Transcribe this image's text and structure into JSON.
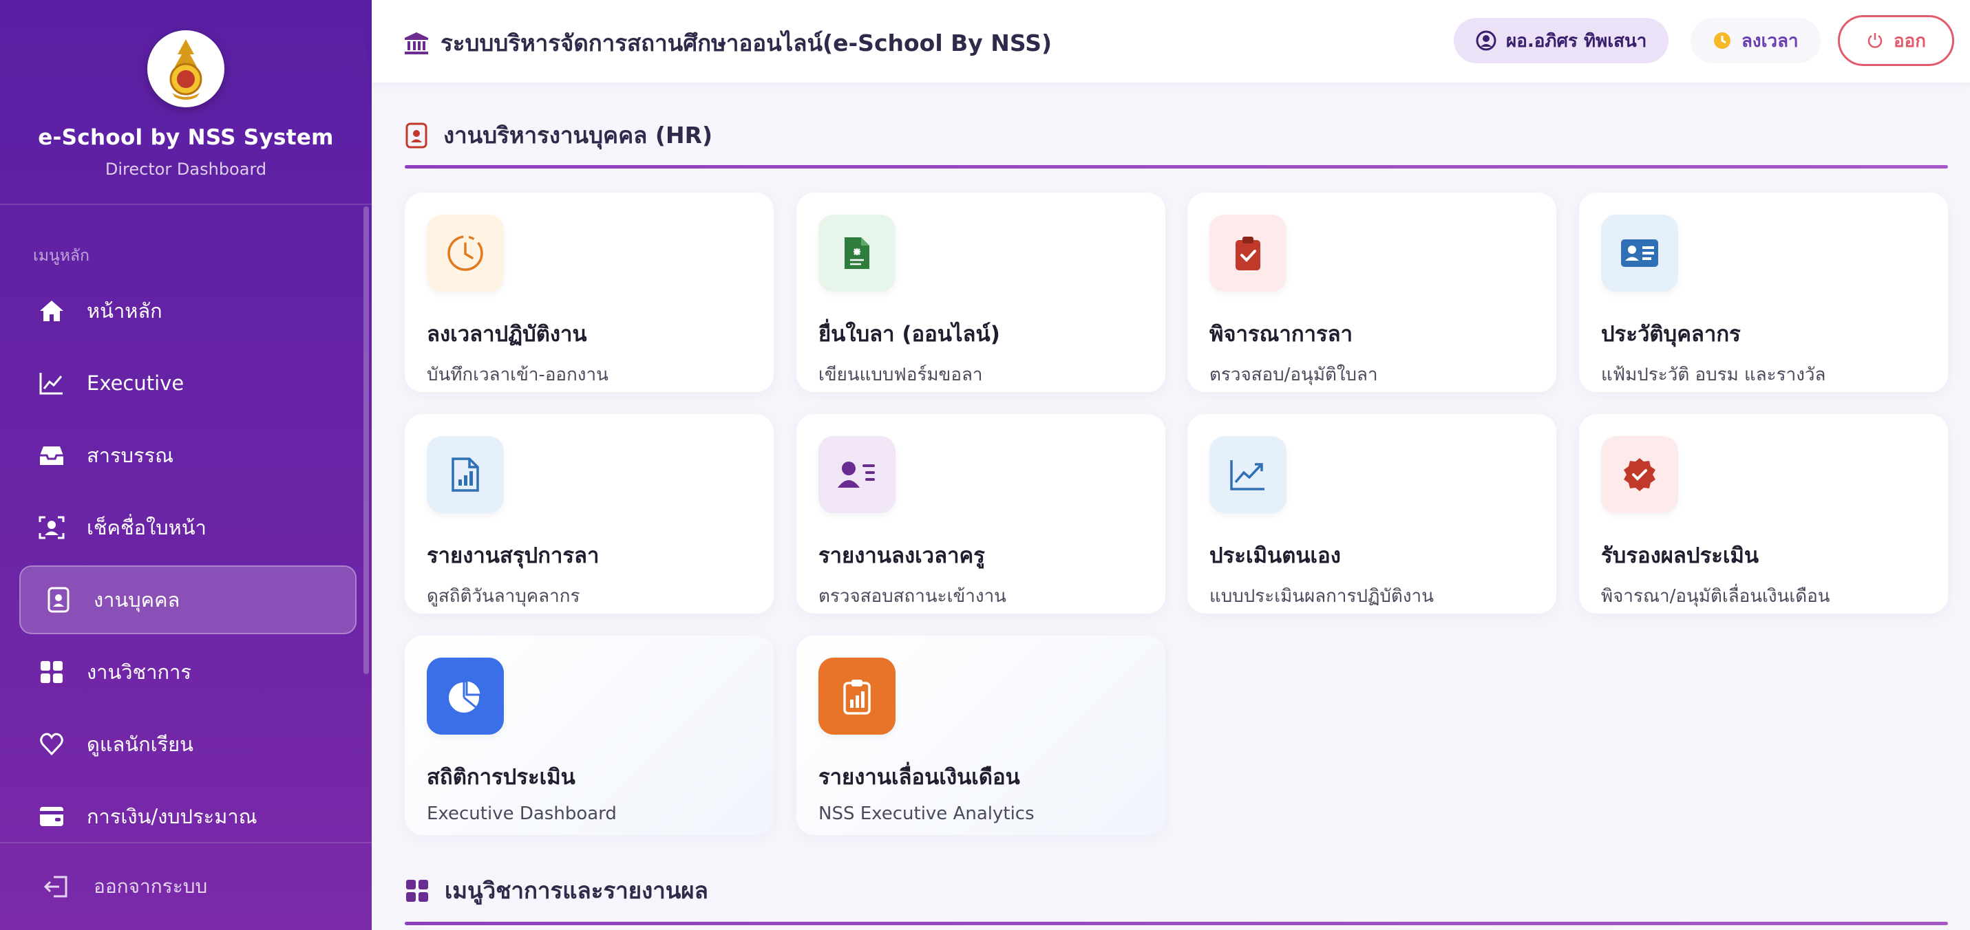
{
  "sidebar": {
    "brand_title": "e-School by NSS System",
    "brand_subtitle": "Director Dashboard",
    "menu_caption": "เมนูหลัก",
    "items": [
      {
        "label": "หน้าหลัก",
        "icon": "home-icon"
      },
      {
        "label": "Executive",
        "icon": "chart-line-icon"
      },
      {
        "label": "สารบรรณ",
        "icon": "inbox-icon"
      },
      {
        "label": "เช็คชื่อใบหน้า",
        "icon": "face-scan-icon"
      },
      {
        "label": "งานบุคคล",
        "icon": "id-badge-icon",
        "active": true
      },
      {
        "label": "งานวิชาการ",
        "icon": "grid-icon"
      },
      {
        "label": "ดูแลนักเรียน",
        "icon": "heart-icon"
      },
      {
        "label": "การเงิน/งบประมาณ",
        "icon": "wallet-icon"
      }
    ],
    "logout_label": "ออกจากระบบ"
  },
  "topbar": {
    "title": "ระบบบริหารจัดการสถานศึกษาออนไลน์(e-School By NSS)",
    "user_name": "ผอ.อภิศร ทิพเสนา",
    "clock_label": "ลงเวลา",
    "logout_label": "ออก"
  },
  "hr_section": {
    "title": "งานบริหารงานบุคคล (HR)",
    "cards": [
      {
        "title": "ลงเวลาปฏิบัติงาน",
        "subtitle": "บันทึกเวลาเข้า-ออกงาน",
        "icon": "clock-icon",
        "color": "#e07a1f",
        "bg": "#fff4e4"
      },
      {
        "title": "ยื่นใบลา (ออนไลน์)",
        "subtitle": "เขียนแบบฟอร์มขอลา",
        "icon": "file-medical-icon",
        "color": "#2e7d3c",
        "bg": "#e8f5ea"
      },
      {
        "title": "พิจารณาการลา",
        "subtitle": "ตรวจสอบ/อนุมัติใบลา",
        "icon": "clipboard-check-icon",
        "color": "#c0392b",
        "bg": "#fdeaea"
      },
      {
        "title": "ประวัติบุคลากร",
        "subtitle": "แฟ้มประวัติ อบรม และรางวัล",
        "icon": "id-card-icon",
        "color": "#2e6fb5",
        "bg": "#e6f0fb"
      },
      {
        "title": "รายงานสรุปการลา",
        "subtitle": "ดูสถิติวันลาบุคลากร",
        "icon": "file-chart-icon",
        "color": "#2e6fb5",
        "bg": "#e6f0fb"
      },
      {
        "title": "รายงานลงเวลาครู",
        "subtitle": "ตรวจสอบสถานะเข้างาน",
        "icon": "user-list-icon",
        "color": "#6a2c91",
        "bg": "#f1e6f6"
      },
      {
        "title": "ประเมินตนเอง",
        "subtitle": "แบบประเมินผลการปฏิบัติงาน",
        "icon": "trend-chart-icon",
        "color": "#2e6fb5",
        "bg": "#e6f0fb"
      },
      {
        "title": "รับรองผลประเมิน",
        "subtitle": "พิจารณา/อนุมัติเลื่อนเงินเดือน",
        "icon": "certificate-icon",
        "color": "#c0392b",
        "bg": "#fdeaea"
      },
      {
        "title": "สถิติการประเมิน",
        "subtitle": "Executive Dashboard",
        "icon": "pie-chart-icon",
        "color": "#ffffff",
        "bg": "#3a6fe8"
      },
      {
        "title": "รายงานเลื่อนเงินเดือน",
        "subtitle": "NSS Executive Analytics",
        "icon": "clipboard-chart-icon",
        "color": "#ffffff",
        "bg": "#e8742a"
      }
    ]
  },
  "academic_section": {
    "title": "เมนูวิชาการและรายงานผล"
  }
}
